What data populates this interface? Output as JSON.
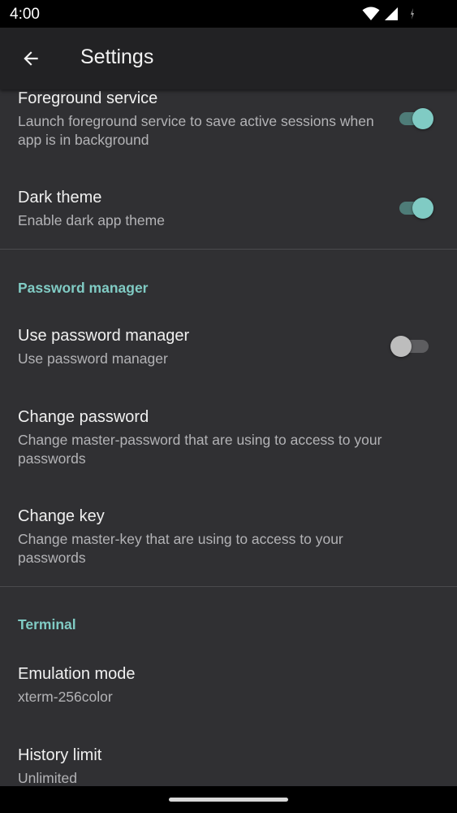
{
  "status_bar": {
    "time": "4:00",
    "icons": [
      "wifi-icon",
      "cell-signal-icon",
      "battery-charging-icon"
    ]
  },
  "app_bar": {
    "title": "Settings",
    "back_icon": "arrow-left-icon"
  },
  "colors": {
    "accent": "#80cbc4",
    "background": "#303033",
    "app_bar": "#222224",
    "divider": "#4a4a4d"
  },
  "preferences": {
    "foreground_service": {
      "title": "Foreground service",
      "summary": "Launch foreground service to save active sessions when app is in background",
      "enabled": true
    },
    "dark_theme": {
      "title": "Dark theme",
      "summary": "Enable dark app theme",
      "enabled": true
    },
    "password_category": "Password manager",
    "use_password_manager": {
      "title": "Use password manager",
      "summary": "Use password manager",
      "enabled": false
    },
    "change_password": {
      "title": "Change password",
      "summary": "Change master-password that are using to access to your passwords"
    },
    "change_key": {
      "title": "Change key",
      "summary": "Change master-key that are using to access to your passwords"
    },
    "terminal_category": "Terminal",
    "emulation_mode": {
      "title": "Emulation mode",
      "summary": "xterm-256color"
    },
    "history_limit": {
      "title": "History limit",
      "summary": "Unlimited"
    }
  }
}
